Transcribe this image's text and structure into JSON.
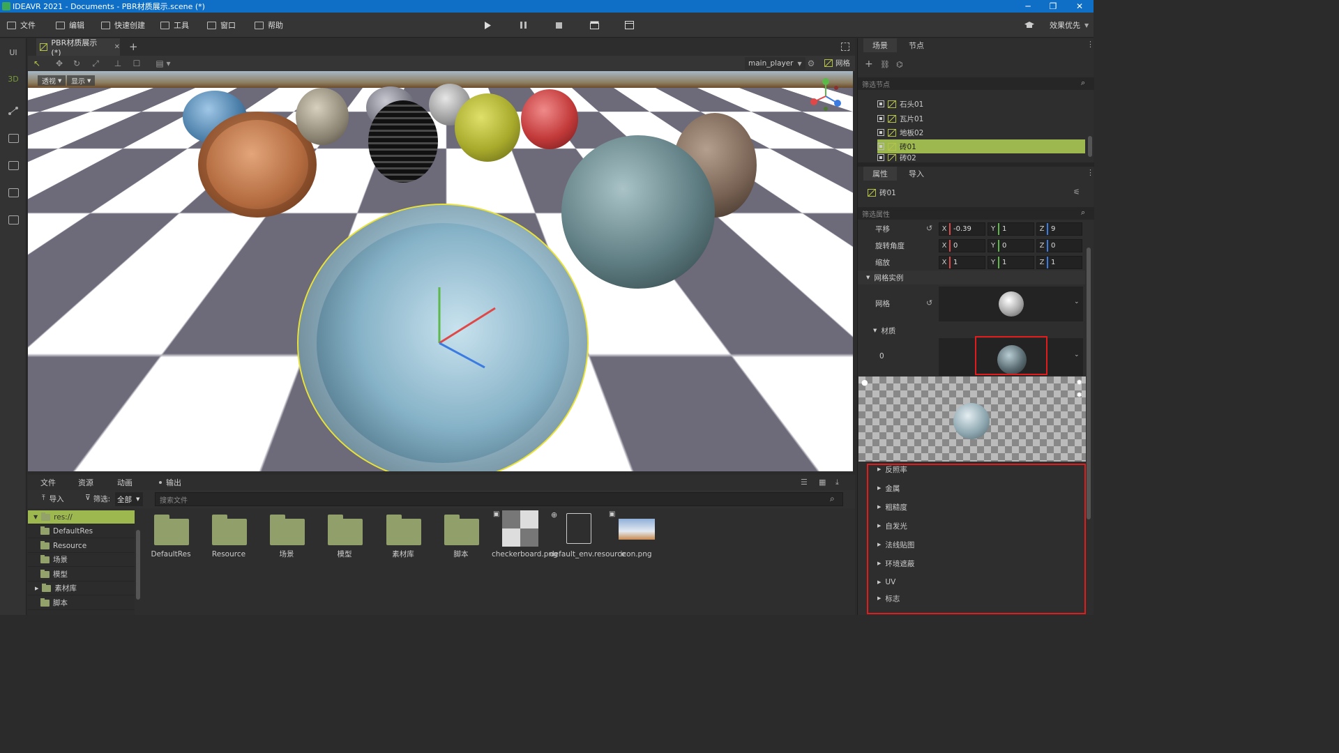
{
  "window": {
    "title": "IDEAVR 2021 - Documents - PBR材质展示.scene (*)",
    "minimize": "─",
    "restore": "❐",
    "close": "✕"
  },
  "menu": {
    "items": [
      "文件",
      "编辑",
      "快速创建",
      "工具",
      "窗口",
      "帮助"
    ],
    "right_label": "效果优先"
  },
  "left_toolbar": {
    "ui": "UI",
    "three_d": "3D"
  },
  "doc_tab": {
    "label": "PBR材质展示(*)",
    "close": "✕",
    "add": "+"
  },
  "viewport": {
    "view_mode": "透视",
    "display": "显示",
    "player": "main_player",
    "grid_label": "网格"
  },
  "bottom": {
    "tabs": [
      "文件",
      "资源",
      "动画",
      "输出"
    ],
    "import_label": "导入",
    "filter_label": "筛选:",
    "filter_value": "全部",
    "search_placeholder": "搜索文件",
    "tree": [
      {
        "label": "res://",
        "selected": true
      },
      {
        "label": "DefaultRes"
      },
      {
        "label": "Resource"
      },
      {
        "label": "场景"
      },
      {
        "label": "模型"
      },
      {
        "label": "素材库",
        "expandable": true
      },
      {
        "label": "脚本"
      }
    ],
    "files": [
      {
        "name": "DefaultRes",
        "kind": "folder"
      },
      {
        "name": "Resource",
        "kind": "folder"
      },
      {
        "name": "场景",
        "kind": "folder"
      },
      {
        "name": "模型",
        "kind": "folder"
      },
      {
        "name": "素材库",
        "kind": "folder"
      },
      {
        "name": "脚本",
        "kind": "folder"
      },
      {
        "name": "checkerboard.png",
        "kind": "image"
      },
      {
        "name": "default_env.resource",
        "kind": "resource"
      },
      {
        "name": "icon.png",
        "kind": "image"
      }
    ]
  },
  "scene_panel": {
    "tabs": [
      "场景",
      "节点"
    ],
    "filter_placeholder": "筛选节点",
    "nodes": [
      "石头01",
      "瓦片01",
      "地板02",
      "砖01",
      "砖02"
    ],
    "selected_node": "砖01"
  },
  "inspector": {
    "tabs": [
      "属性",
      "导入"
    ],
    "object_name": "砖01",
    "filter_placeholder": "筛选属性",
    "transform": [
      {
        "label": "平移",
        "x": "-0.39",
        "y": "1",
        "z": "9"
      },
      {
        "label": "旋转角度",
        "x": "0",
        "y": "0",
        "z": "0"
      },
      {
        "label": "缩放",
        "x": "1",
        "y": "1",
        "z": "1"
      }
    ],
    "axis": {
      "x": "X",
      "y": "Y",
      "z": "Z"
    },
    "mesh_instance_section": "网格实例",
    "mesh_label": "网格",
    "material_section": "材质",
    "material_index": "0",
    "material_groups": [
      "反照率",
      "金属",
      "粗糙度",
      "自发光",
      "法线贴图",
      "环境遮蔽",
      "UV",
      "标志"
    ]
  },
  "colors": {
    "titlebar": "#0f6fc6",
    "selection": "#9db84e",
    "highlight_box": "#e01c1c",
    "folder": "#91a06a"
  }
}
